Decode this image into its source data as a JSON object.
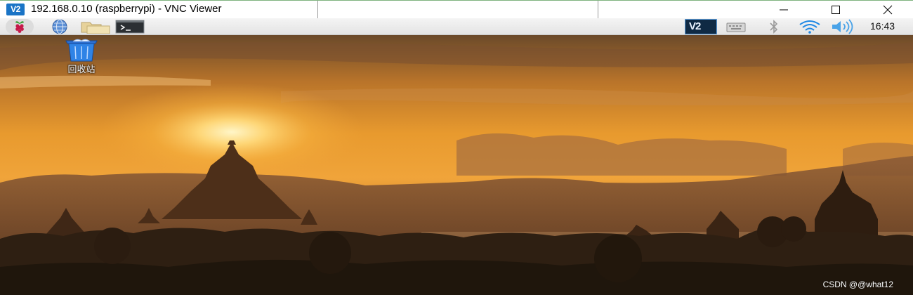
{
  "window": {
    "logo_text": "V2",
    "title": "192.168.0.10 (raspberrypi) - VNC Viewer",
    "minimize_label": "minimize-icon",
    "maximize_label": "maximize-icon",
    "close_label": "close-icon"
  },
  "panel": {
    "launchers": [
      {
        "name": "raspberry-menu",
        "icon": "raspberry-icon"
      },
      {
        "name": "web-browser",
        "icon": "globe-icon"
      },
      {
        "name": "file-manager",
        "icon": "folder-icon"
      },
      {
        "name": "terminal",
        "icon": "terminal-icon"
      }
    ],
    "tray": {
      "vnc_logo": "V2",
      "keyboard_icon": "keyboard-icon",
      "bluetooth_icon": "bluetooth-icon",
      "wifi_icon": "wifi-icon",
      "volume_icon": "volume-icon",
      "clock": "16:43"
    }
  },
  "desktop": {
    "icons": [
      {
        "label": "回收站",
        "icon": "trash-icon"
      }
    ],
    "wallpaper": "sunset-temples-wallpaper",
    "watermark": "CSDN @@what12"
  },
  "colors": {
    "vnc_blue": "#1a74c6",
    "panel_bg": "#e8e8e8",
    "tray_active": "#0f2a44",
    "wifi_blue": "#1e88e5",
    "sky_orange": "#e99a2c"
  }
}
